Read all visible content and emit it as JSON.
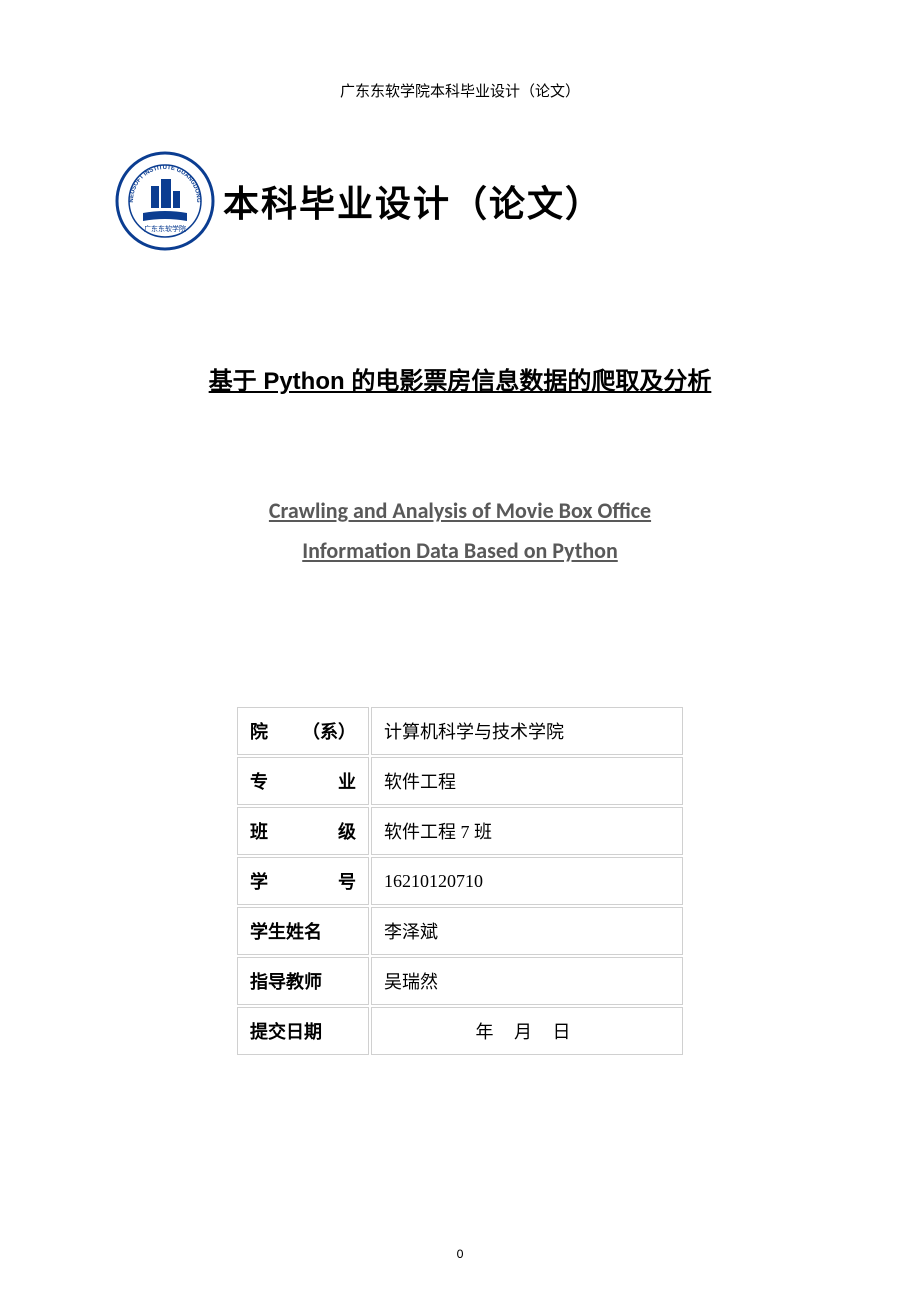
{
  "header": "广东东软学院本科毕业设计（论文）",
  "main_title": "本科毕业设计（论文）",
  "subtitle_cn": "基于 Python 的电影票房信息数据的爬取及分析",
  "subtitle_en_line1": "Crawling and Analysis of Movie Box Office",
  "subtitle_en_line2": "Information Data Based on Python",
  "info": {
    "rows": [
      {
        "label_parts": [
          "院",
          "（系）"
        ],
        "value": "计算机科学与技术学院"
      },
      {
        "label_parts": [
          "专",
          "业"
        ],
        "value": "软件工程"
      },
      {
        "label_parts": [
          "班",
          "级"
        ],
        "value": "软件工程 7 班"
      },
      {
        "label_parts": [
          "学",
          "号"
        ],
        "value": "16210120710"
      },
      {
        "label": "学生姓名",
        "value": "李泽斌"
      },
      {
        "label": "指导教师",
        "value": "吴瑞然"
      },
      {
        "label": "提交日期",
        "value_date": "年  月  日"
      }
    ]
  },
  "page_number": "0",
  "logo": {
    "ring_color": "#0b3d91",
    "text_top": "NEUSOFT INSTITUTE GUANGDONG",
    "building_color": "#0b3d91"
  }
}
